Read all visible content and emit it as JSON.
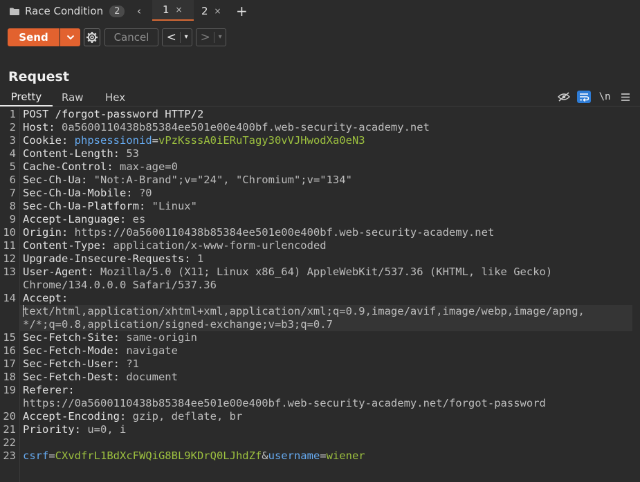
{
  "tabs": {
    "group_name": "Race Condition",
    "group_count": "2",
    "prev_arrow": "‹",
    "items": [
      {
        "label": "1",
        "close": "×"
      },
      {
        "label": "2",
        "close": "×"
      }
    ],
    "add": "+"
  },
  "toolbar": {
    "send_label": "Send",
    "cancel_label": "Cancel",
    "back_label": "<",
    "forward_label": ">",
    "dropdown_glyph": "▾"
  },
  "request": {
    "title": "Request",
    "view_tabs": [
      "Pretty",
      "Raw",
      "Hex"
    ],
    "newline_toggle": "\\n"
  },
  "colors": {
    "accent": "#e2622f",
    "header_key": "#e0e0e0",
    "cookie_name": "#66aaf0",
    "cookie_value": "#9dc13f",
    "wrap_active": "#2e7cd6"
  },
  "editor": {
    "lines": [
      {
        "n": "1",
        "k": "POST /forgot-password HTTP/2"
      },
      {
        "n": "2",
        "k": "Host:",
        "v": " 0a5600110438b85384ee501e00e400bf.web-security-academy.net"
      },
      {
        "n": "3",
        "k": "Cookie:",
        "cookie_name": "phpsessionid",
        "cookie_value": "vPzKsssA0iERuTagy30vVJHwodXa0eN3"
      },
      {
        "n": "4",
        "k": "Content-Length:",
        "v": " 53"
      },
      {
        "n": "5",
        "k": "Cache-Control:",
        "v": " max-age=0"
      },
      {
        "n": "6",
        "k": "Sec-Ch-Ua:",
        "v": " \"Not:A-Brand\";v=\"24\", \"Chromium\";v=\"134\""
      },
      {
        "n": "7",
        "k": "Sec-Ch-Ua-Mobile:",
        "v": " ?0"
      },
      {
        "n": "8",
        "k": "Sec-Ch-Ua-Platform:",
        "v": " \"Linux\""
      },
      {
        "n": "9",
        "k": "Accept-Language:",
        "v": " es"
      },
      {
        "n": "10",
        "k": "Origin:",
        "v": " https://0a5600110438b85384ee501e00e400bf.web-security-academy.net"
      },
      {
        "n": "11",
        "k": "Content-Type:",
        "v": " application/x-www-form-urlencoded"
      },
      {
        "n": "12",
        "k": "Upgrade-Insecure-Requests:",
        "v": " 1"
      },
      {
        "n": "13",
        "k": "User-Agent:",
        "v": " Mozilla/5.0 (X11; Linux x86_64) AppleWebKit/537.36 (KHTML, like Gecko)",
        "wrap": "Chrome/134.0.0.0 Safari/537.36"
      },
      {
        "n": "14",
        "k": "Accept:",
        "wrap": "text/html,application/xhtml+xml,application/xml;q=0.9,image/avif,image/webp,image/apng,",
        "wrap2": "*/*;q=0.8,application/signed-exchange;v=b3;q=0.7"
      },
      {
        "n": "15",
        "k": "Sec-Fetch-Site:",
        "v": " same-origin"
      },
      {
        "n": "16",
        "k": "Sec-Fetch-Mode:",
        "v": " navigate"
      },
      {
        "n": "17",
        "k": "Sec-Fetch-User:",
        "v": " ?1"
      },
      {
        "n": "18",
        "k": "Sec-Fetch-Dest:",
        "v": " document"
      },
      {
        "n": "19",
        "k": "Referer:",
        "wrap": "https://0a5600110438b85384ee501e00e400bf.web-security-academy.net/forgot-password"
      },
      {
        "n": "20",
        "k": "Accept-Encoding:",
        "v": " gzip, deflate, br"
      },
      {
        "n": "21",
        "k": "Priority:",
        "v": " u=0, i"
      },
      {
        "n": "22"
      },
      {
        "n": "23",
        "body": [
          {
            "pk": "csrf"
          },
          {
            "t": "="
          },
          {
            "pv": "CXvdfrL1BdXcFWQiG8BL9KDrQ0LJhdZf"
          },
          {
            "t": "&"
          },
          {
            "pk": "username"
          },
          {
            "t": "="
          },
          {
            "pv": "wiener"
          }
        ]
      }
    ]
  }
}
